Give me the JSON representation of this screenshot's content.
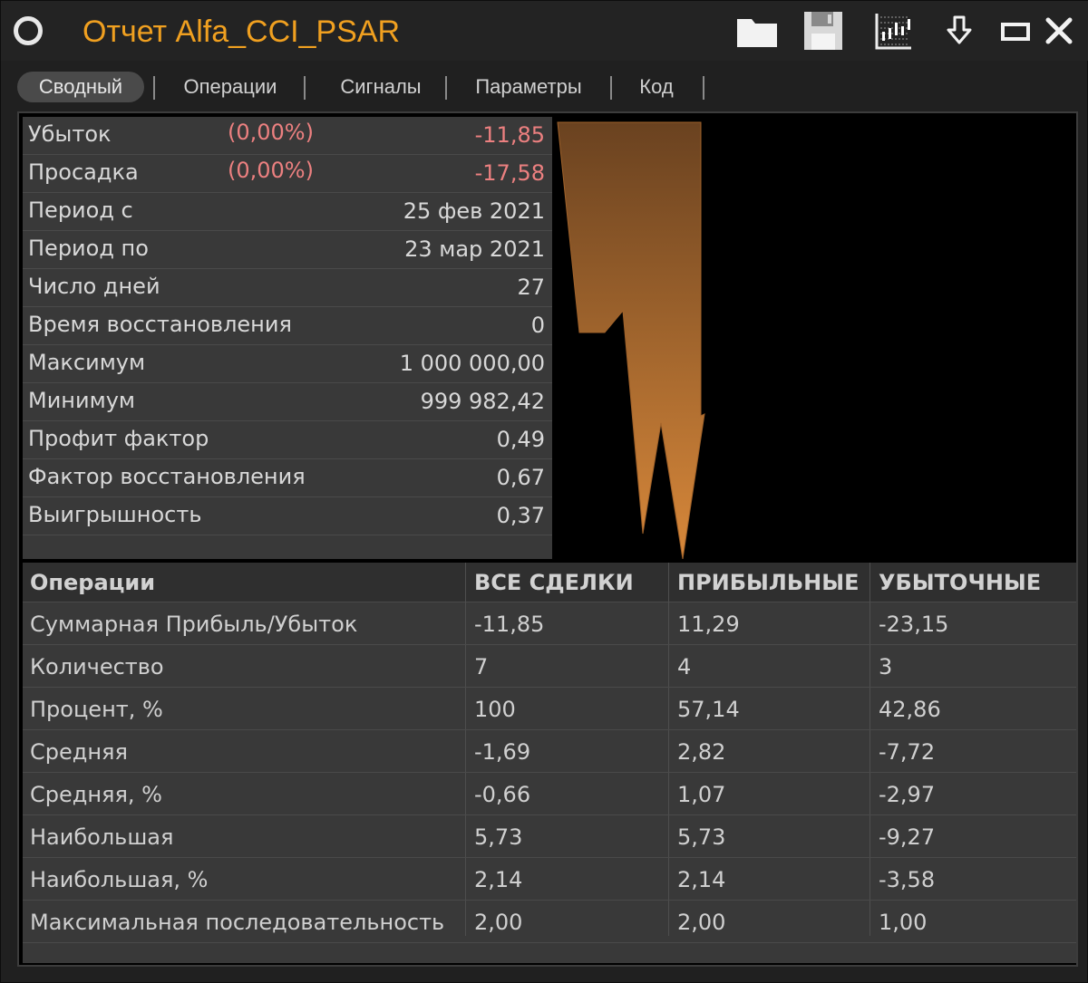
{
  "window": {
    "title": "Отчет Alfa_CCI_PSAR",
    "buttons": [
      "folder-icon",
      "save-icon",
      "chart-settings-icon",
      "download-icon",
      "minimize-icon",
      "close-icon"
    ]
  },
  "tabs": [
    {
      "label": "Сводный",
      "active": true
    },
    {
      "label": "Операции",
      "active": false
    },
    {
      "label": "Сигналы",
      "active": false
    },
    {
      "label": "Параметры",
      "active": false
    },
    {
      "label": "Код",
      "active": false
    }
  ],
  "summary": [
    {
      "label": "Убыток",
      "pct": "(0,00%)",
      "value": "-11,85",
      "negative": true
    },
    {
      "label": "Просадка",
      "pct": "(0,00%)",
      "value": "-17,58",
      "negative": true
    },
    {
      "label": "Период с",
      "pct": "",
      "value": "25 фев 2021",
      "negative": false
    },
    {
      "label": "Период по",
      "pct": "",
      "value": "23 мар 2021",
      "negative": false
    },
    {
      "label": "Число дней",
      "pct": "",
      "value": "27",
      "negative": false
    },
    {
      "label": "Время восстановления",
      "pct": "",
      "value": "0",
      "negative": false
    },
    {
      "label": "Максимум",
      "pct": "",
      "value": "1 000 000,00",
      "negative": false
    },
    {
      "label": "Минимум",
      "pct": "",
      "value": "999 982,42",
      "negative": false
    },
    {
      "label": "Профит фактор",
      "pct": "",
      "value": "0,49",
      "negative": false
    },
    {
      "label": "Фактор восстановления",
      "pct": "",
      "value": "0,67",
      "negative": false
    },
    {
      "label": "Выигрышность",
      "pct": "",
      "value": "0,37",
      "negative": false
    }
  ],
  "operations": {
    "headers": [
      "Операции",
      "ВСЕ СДЕЛКИ",
      "ПРИБЫЛЬНЫЕ",
      "УБЫТОЧНЫЕ"
    ],
    "rows": [
      [
        "Суммарная Прибыль/Убыток",
        "-11,85",
        "11,29",
        "-23,15"
      ],
      [
        "Количество",
        "7",
        "4",
        "3"
      ],
      [
        "Процент, %",
        "100",
        "57,14",
        "42,86"
      ],
      [
        "Средняя",
        "-1,69",
        "2,82",
        "-7,72"
      ],
      [
        "Средняя, %",
        "-0,66",
        "1,07",
        "-2,97"
      ],
      [
        "Наибольшая",
        "5,73",
        "5,73",
        "-9,27"
      ],
      [
        "Наибольшая, %",
        "2,14",
        "2,14",
        "-3,58"
      ],
      [
        "Максимальная последовательность",
        "2,00",
        "2,00",
        "1,00"
      ]
    ]
  },
  "colors": {
    "title": "#f0a020",
    "negative": "#ec8080",
    "chart_top": "#6a4220",
    "chart_bottom": "#d8883a"
  }
}
